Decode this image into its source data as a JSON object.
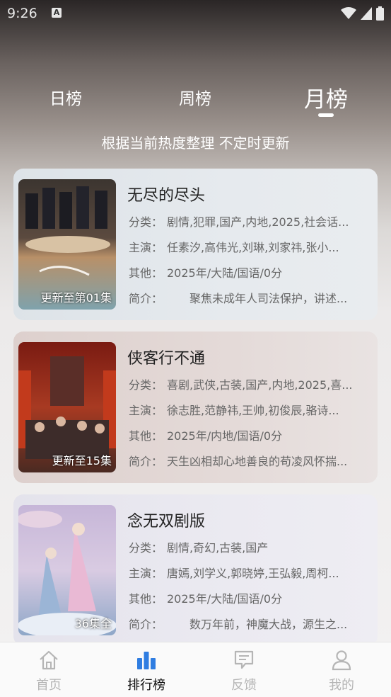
{
  "status_bar": {
    "time": "9:26",
    "notification_icon": "A"
  },
  "tabs": [
    {
      "label": "日榜",
      "active": false
    },
    {
      "label": "周榜",
      "active": false
    },
    {
      "label": "月榜",
      "active": true
    }
  ],
  "subtitle": "根据当前热度整理 不定时更新",
  "items": [
    {
      "title": "无尽的尽头",
      "badge": "更新至第01集",
      "category_label": "分类：",
      "category": "剧情,犯罪,国产,内地,2025,社会话...",
      "cast_label": "主演：",
      "cast": "任素汐,高伟光,刘琳,刘家祎,张小...",
      "other_label": "其他：",
      "other": "2025年/大陆/国语/0分",
      "intro_label": "简介：",
      "intro": "　　聚焦未成年人司法保护，讲述..."
    },
    {
      "title": "侠客行不通",
      "badge": "更新至15集",
      "category_label": "分类：",
      "category": "喜剧,武侠,古装,国产,内地,2025,喜...",
      "cast_label": "主演：",
      "cast": "徐志胜,范静祎,王帅,初俊辰,骆诗...",
      "other_label": "其他：",
      "other": "2025年/内地/国语/0分",
      "intro_label": "简介：",
      "intro": "天生凶相却心地善良的苟凌风怀揣..."
    },
    {
      "title": "念无双剧版",
      "badge": "36集全",
      "category_label": "分类：",
      "category": "剧情,奇幻,古装,国产",
      "cast_label": "主演：",
      "cast": "唐嫣,刘学义,郭晓婷,王弘毅,周柯...",
      "other_label": "其他：",
      "other": "2025年/大陆/国语/0分",
      "intro_label": "简介：",
      "intro": "　　数万年前，神魔大战，源生之..."
    }
  ],
  "bottom_nav": [
    {
      "label": "首页",
      "icon": "home-icon",
      "active": false
    },
    {
      "label": "排行榜",
      "icon": "bar-chart-icon",
      "active": true
    },
    {
      "label": "反馈",
      "icon": "feedback-icon",
      "active": false
    },
    {
      "label": "我的",
      "icon": "user-icon",
      "active": false
    }
  ],
  "colors": {
    "accent": "#2f7de1",
    "inactive": "#b5b5b5"
  }
}
